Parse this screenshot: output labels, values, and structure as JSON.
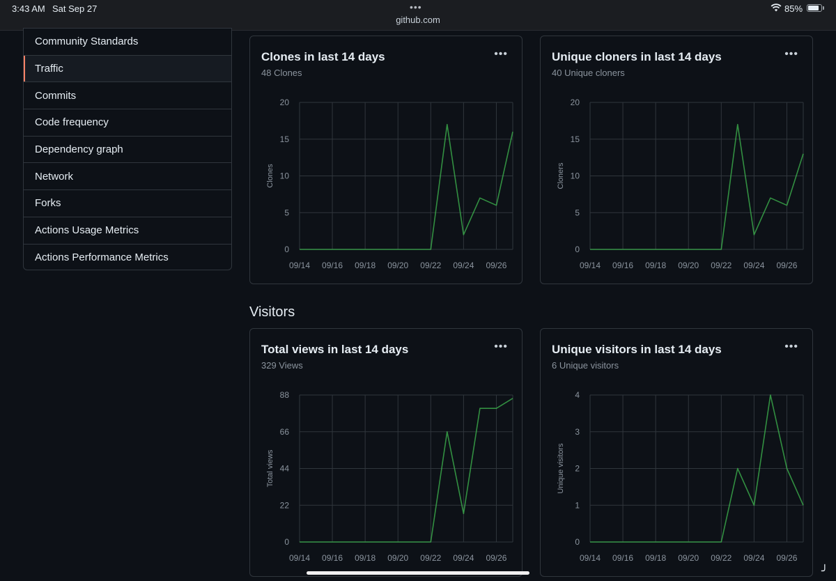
{
  "status_bar": {
    "time": "3:43 AM",
    "date": "Sat Sep 27",
    "url": "github.com",
    "battery_pct": "85%",
    "battery_level": 0.85,
    "more_icon": "ellipsis-icon",
    "wifi_icon": "wifi-icon"
  },
  "sidebar": {
    "items": [
      {
        "label": "Community Standards",
        "active": false
      },
      {
        "label": "Traffic",
        "active": true
      },
      {
        "label": "Commits",
        "active": false
      },
      {
        "label": "Code frequency",
        "active": false
      },
      {
        "label": "Dependency graph",
        "active": false
      },
      {
        "label": "Network",
        "active": false
      },
      {
        "label": "Forks",
        "active": false
      },
      {
        "label": "Actions Usage Metrics",
        "active": false
      },
      {
        "label": "Actions Performance Metrics",
        "active": false
      }
    ],
    "accent": "#f78166"
  },
  "visitors_heading": "Visitors",
  "colors": {
    "line": "#3fb950",
    "grid": "#30363d",
    "axis_text": "#8b949e"
  },
  "cards": [
    {
      "title": "Clones in last 14 days",
      "subtitle": "48 Clones"
    },
    {
      "title": "Unique cloners in last 14 days",
      "subtitle": "40 Unique cloners"
    },
    {
      "title": "Total views in last 14 days",
      "subtitle": "329 Views"
    },
    {
      "title": "Unique visitors in last 14 days",
      "subtitle": "6 Unique visitors"
    }
  ],
  "chart_data": [
    {
      "type": "line",
      "title": "Clones in last 14 days",
      "ylabel": "Clones",
      "xlabel": "",
      "x": [
        "09/14",
        "09/15",
        "09/16",
        "09/17",
        "09/18",
        "09/19",
        "09/20",
        "09/21",
        "09/22",
        "09/23",
        "09/24",
        "09/25",
        "09/26",
        "09/27"
      ],
      "x_tick_labels": [
        "09/14",
        "09/16",
        "09/18",
        "09/20",
        "09/22",
        "09/24",
        "09/26"
      ],
      "y_ticks": [
        0,
        5,
        10,
        15,
        20
      ],
      "ylim": [
        0,
        20
      ],
      "grid": true,
      "series": [
        {
          "values": [
            0,
            0,
            0,
            0,
            0,
            0,
            0,
            0,
            0,
            17,
            2,
            7,
            6,
            16
          ]
        }
      ]
    },
    {
      "type": "line",
      "title": "Unique cloners in last 14 days",
      "ylabel": "Cloners",
      "xlabel": "",
      "x": [
        "09/14",
        "09/15",
        "09/16",
        "09/17",
        "09/18",
        "09/19",
        "09/20",
        "09/21",
        "09/22",
        "09/23",
        "09/24",
        "09/25",
        "09/26",
        "09/27"
      ],
      "x_tick_labels": [
        "09/14",
        "09/16",
        "09/18",
        "09/20",
        "09/22",
        "09/24",
        "09/26"
      ],
      "y_ticks": [
        0,
        5,
        10,
        15,
        20
      ],
      "ylim": [
        0,
        20
      ],
      "grid": true,
      "series": [
        {
          "values": [
            0,
            0,
            0,
            0,
            0,
            0,
            0,
            0,
            0,
            17,
            2,
            7,
            6,
            13
          ]
        }
      ]
    },
    {
      "type": "line",
      "title": "Total views in last 14 days",
      "ylabel": "Total views",
      "xlabel": "",
      "x": [
        "09/14",
        "09/15",
        "09/16",
        "09/17",
        "09/18",
        "09/19",
        "09/20",
        "09/21",
        "09/22",
        "09/23",
        "09/24",
        "09/25",
        "09/26",
        "09/27"
      ],
      "x_tick_labels": [
        "09/14",
        "09/16",
        "09/18",
        "09/20",
        "09/22",
        "09/24",
        "09/26"
      ],
      "y_ticks": [
        0,
        22,
        44,
        66,
        88
      ],
      "ylim": [
        0,
        88
      ],
      "grid": true,
      "series": [
        {
          "values": [
            0,
            0,
            0,
            0,
            0,
            0,
            0,
            0,
            0,
            66,
            17,
            80,
            80,
            86
          ]
        }
      ]
    },
    {
      "type": "line",
      "title": "Unique visitors in last 14 days",
      "ylabel": "Unique visitors",
      "xlabel": "",
      "x": [
        "09/14",
        "09/15",
        "09/16",
        "09/17",
        "09/18",
        "09/19",
        "09/20",
        "09/21",
        "09/22",
        "09/23",
        "09/24",
        "09/25",
        "09/26",
        "09/27"
      ],
      "x_tick_labels": [
        "09/14",
        "09/16",
        "09/18",
        "09/20",
        "09/22",
        "09/24",
        "09/26"
      ],
      "y_ticks": [
        0,
        1,
        2,
        3,
        4
      ],
      "ylim": [
        0,
        4
      ],
      "grid": true,
      "series": [
        {
          "values": [
            0,
            0,
            0,
            0,
            0,
            0,
            0,
            0,
            0,
            2,
            1,
            4,
            2,
            1
          ]
        }
      ]
    }
  ]
}
